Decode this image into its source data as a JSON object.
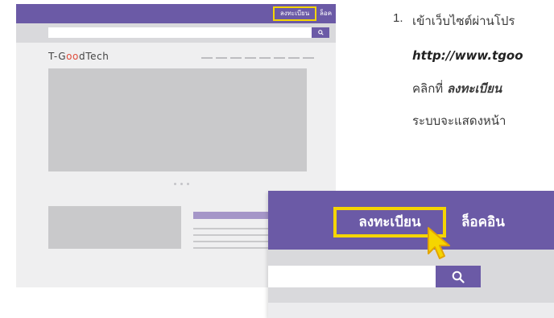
{
  "mock_site": {
    "top_bar": {
      "register_label": "ลงทะเบียน",
      "login_label": "ล็อคอิน"
    },
    "search": {
      "button_icon": "search-icon"
    },
    "logo": {
      "prefix": "T-G",
      "oo": "oo",
      "suffix": "dTech"
    }
  },
  "zoomed_header": {
    "register_label": "ลงทะเบียน",
    "login_label": "ล็อคอิน",
    "search_button_icon": "search-icon",
    "pointer": "hand-pointer-icon"
  },
  "instructions": {
    "step_number": "1.",
    "line1": "เข้าเว็บไซต์ผ่านโปร",
    "url": "http://www.tgoo",
    "line3_prefix": "คลิกที่ ",
    "line3_bold": "ลงทะเบียน",
    "line4": "ระบบจะแสดงหน้า"
  },
  "colors": {
    "brand_purple": "#6b5aa6",
    "highlight_yellow": "#f5d500",
    "logo_accent": "#e04b3a"
  }
}
